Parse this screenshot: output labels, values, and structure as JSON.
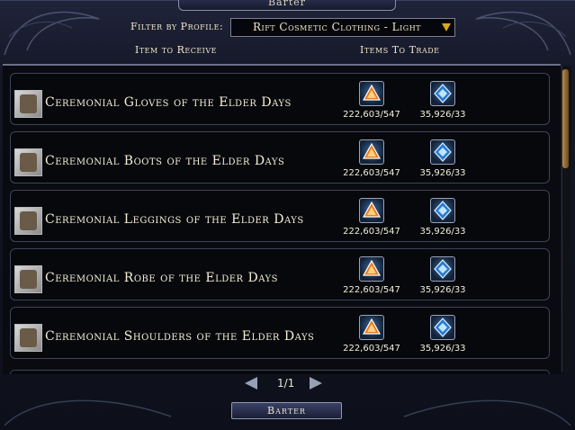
{
  "window": {
    "title": "Barter"
  },
  "filter": {
    "label": "Filter by Profile:",
    "selected": "Rift Cosmetic Clothing - Light"
  },
  "columns": {
    "receive": "Item to Receive",
    "trade": "Items To Trade"
  },
  "rows": [
    {
      "name": "Ceremonial Gloves of the Elder Days",
      "trade1_qty": "222,603/547",
      "trade2_qty": "35,926/33"
    },
    {
      "name": "Ceremonial Boots of the Elder Days",
      "trade1_qty": "222,603/547",
      "trade2_qty": "35,926/33"
    },
    {
      "name": "Ceremonial Leggings of the Elder Days",
      "trade1_qty": "222,603/547",
      "trade2_qty": "35,926/33"
    },
    {
      "name": "Ceremonial Robe of the Elder Days",
      "trade1_qty": "222,603/547",
      "trade2_qty": "35,926/33"
    },
    {
      "name": "Ceremonial Shoulders of the Elder Days",
      "trade1_qty": "222,603/547",
      "trade2_qty": "35,926/33"
    }
  ],
  "icons": {
    "receive": [
      "gloves-icon",
      "boots-icon",
      "leggings-icon",
      "robe-icon",
      "shoulders-icon"
    ],
    "trade1": "orange-triangle-token-icon",
    "trade2": "blue-diamond-token-icon"
  },
  "pager": {
    "text": "1/1"
  },
  "actions": {
    "barter_label": "Barter"
  },
  "colors": {
    "accent": "#d8a820",
    "panel": "#0d0f1a",
    "text": "#f4eed6"
  }
}
